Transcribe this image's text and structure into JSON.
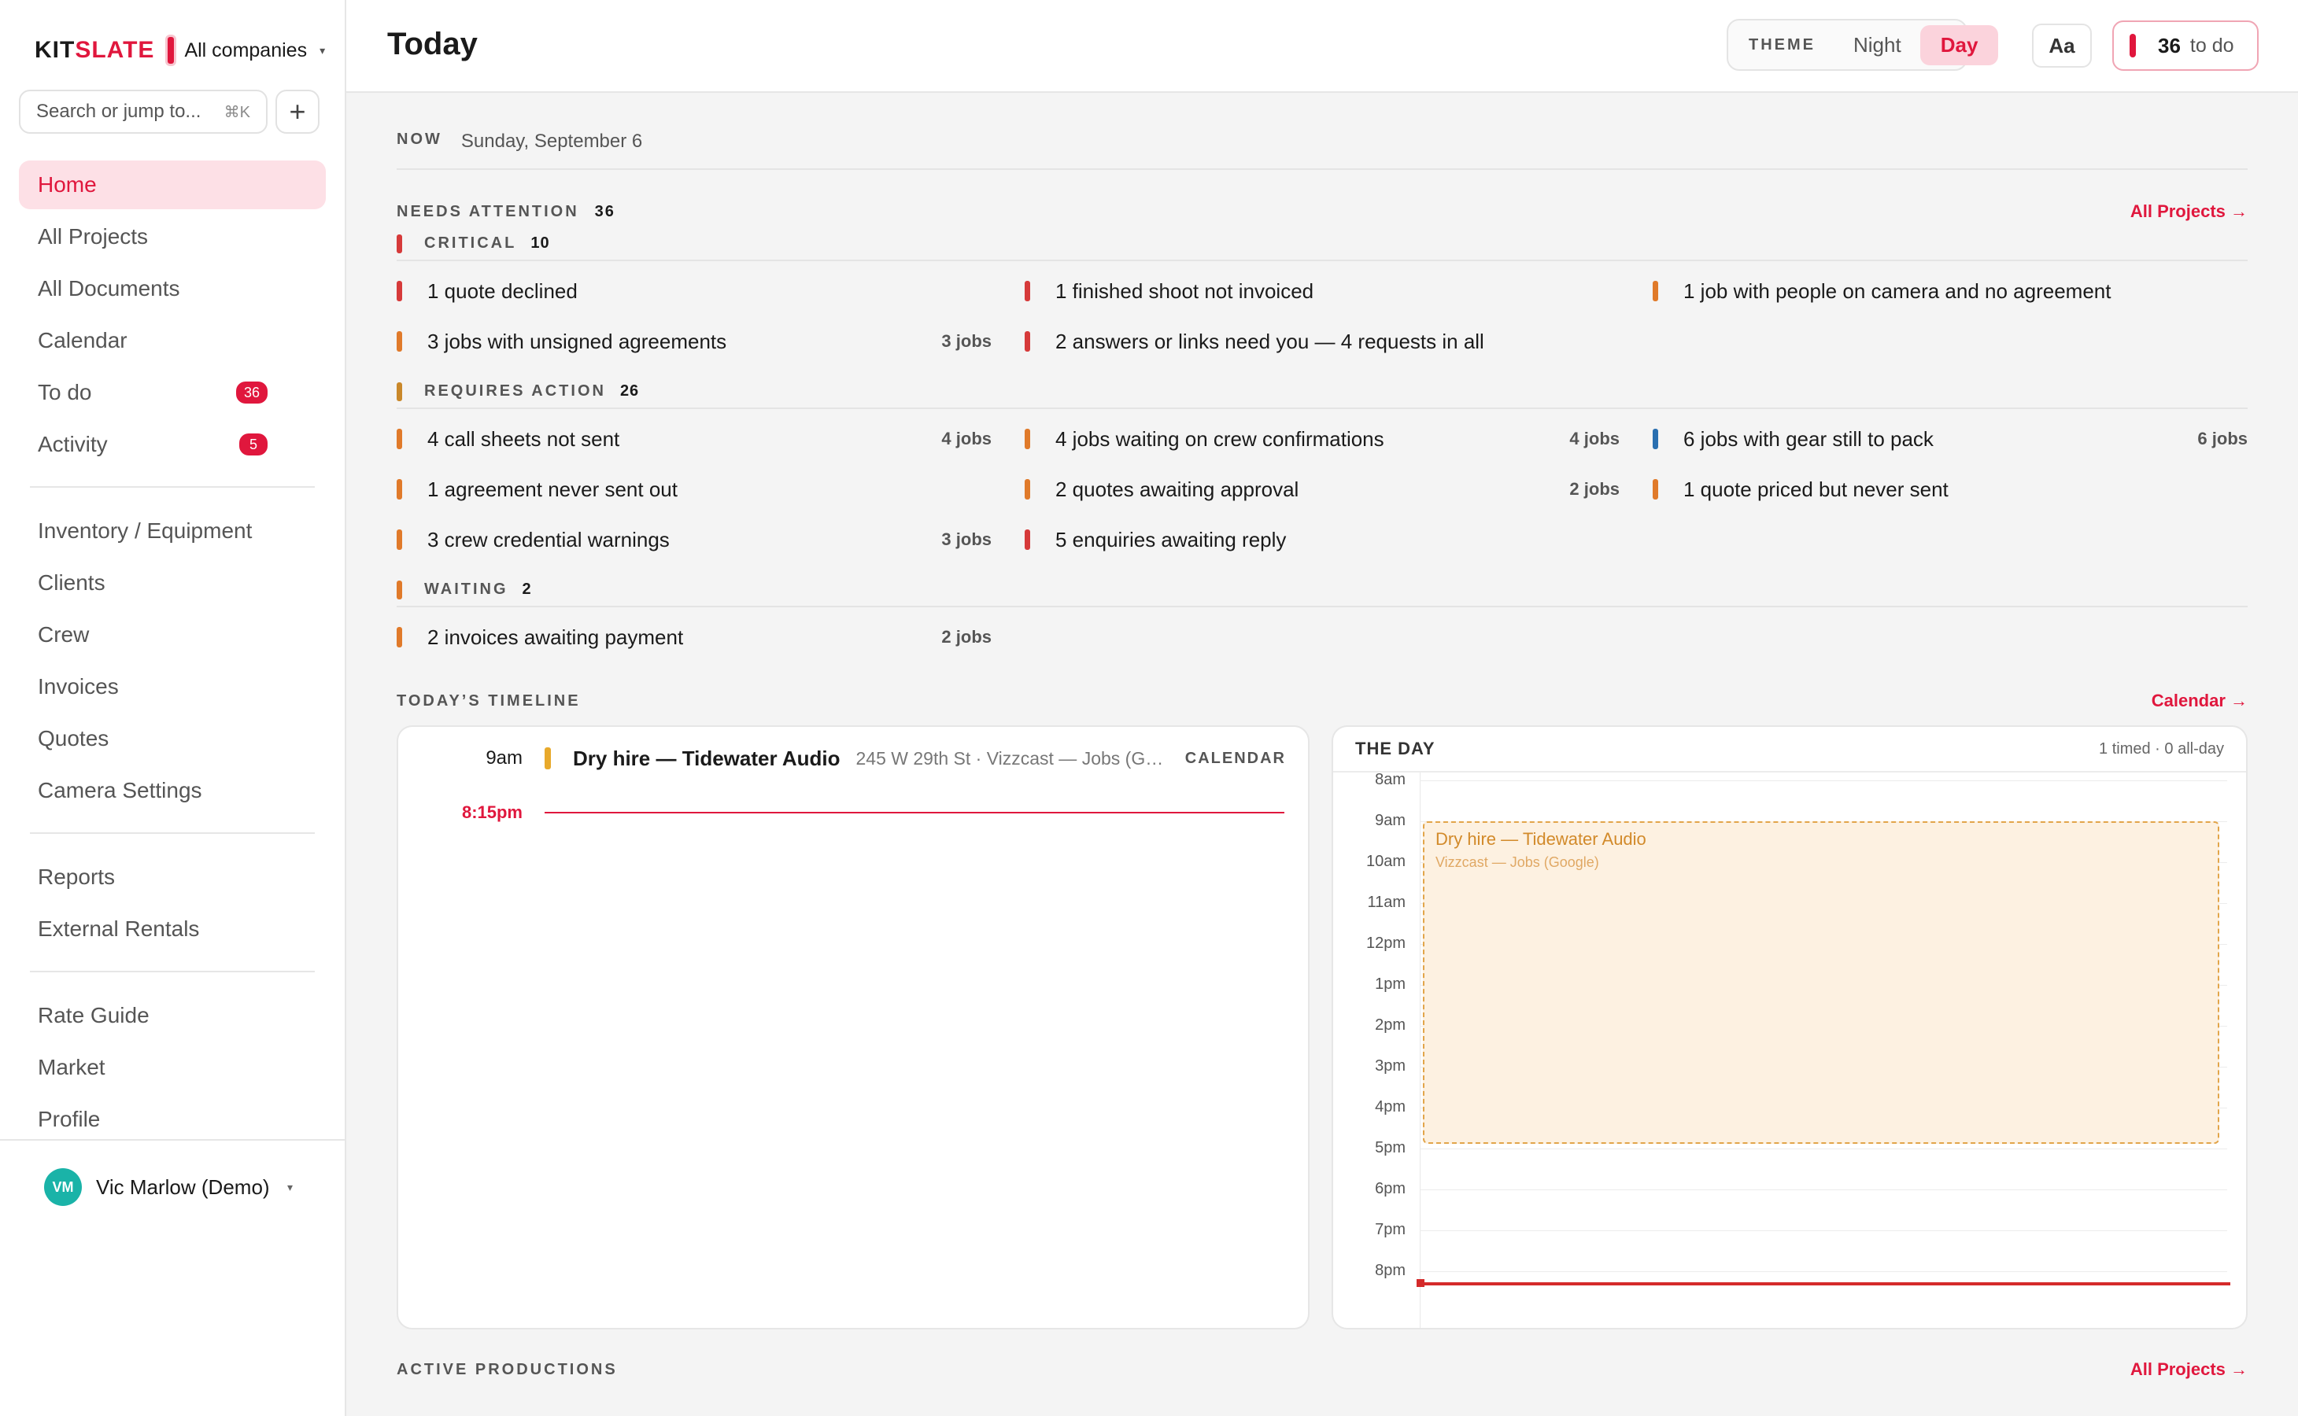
{
  "brand": {
    "logo_part1": "KIT",
    "logo_part2": "SLATE",
    "company": "All companies",
    "caret": "▾"
  },
  "search": {
    "placeholder": "Search or jump to...",
    "shortcut": "⌘K",
    "add_label": "+"
  },
  "nav": {
    "primary": [
      {
        "label": "Home",
        "active": true
      },
      {
        "label": "All Projects"
      },
      {
        "label": "All Documents"
      },
      {
        "label": "Calendar"
      },
      {
        "label": "To do",
        "badge": "36"
      },
      {
        "label": "Activity",
        "badge": "5"
      }
    ],
    "secondary": [
      "Inventory / Equipment",
      "Clients",
      "Crew",
      "Invoices",
      "Quotes",
      "Camera Settings"
    ],
    "tertiary": [
      "Reports",
      "External Rentals"
    ],
    "quaternary": [
      "Rate Guide",
      "Market",
      "Profile"
    ]
  },
  "user": {
    "initials": "VM",
    "name": "Vic Marlow (Demo)",
    "caret": "▾"
  },
  "topbar": {
    "title": "Today",
    "theme_label": "THEME",
    "theme_night": "Night",
    "theme_day": "Day",
    "font_button": "Aa",
    "todo_count": "36",
    "todo_label": "to do"
  },
  "now": {
    "label": "NOW",
    "date": "Sunday, September 6"
  },
  "attention": {
    "label": "NEEDS ATTENTION",
    "count": "36",
    "link": "All Projects →",
    "groups": [
      {
        "name": "CRITICAL",
        "count": "10",
        "color": "#d63a3a",
        "items": [
          {
            "text": "1 quote declined",
            "jobs": "",
            "color": "#d63a3a"
          },
          {
            "text": "1 finished shoot not invoiced",
            "jobs": "",
            "color": "#d63a3a"
          },
          {
            "text": "1 job with people on camera and no agreement",
            "jobs": "",
            "color": "#e07a2a"
          },
          {
            "text": "3 jobs with unsigned agreements",
            "jobs": "3 jobs",
            "color": "#e07a2a"
          },
          {
            "text": "2 answers or links need you — 4 requests in all",
            "jobs": "",
            "color": "#d63a3a"
          }
        ]
      },
      {
        "name": "REQUIRES ACTION",
        "count": "26",
        "color": "#c9882a",
        "items": [
          {
            "text": "4 call sheets not sent",
            "jobs": "4 jobs",
            "color": "#e07a2a"
          },
          {
            "text": "4 jobs waiting on crew confirmations",
            "jobs": "4 jobs",
            "color": "#e07a2a"
          },
          {
            "text": "6 jobs with gear still to pack",
            "jobs": "6 jobs",
            "color": "#2a6fb0"
          },
          {
            "text": "1 agreement never sent out",
            "jobs": "",
            "color": "#e07a2a"
          },
          {
            "text": "2 quotes awaiting approval",
            "jobs": "2 jobs",
            "color": "#e07a2a"
          },
          {
            "text": "1 quote priced but never sent",
            "jobs": "",
            "color": "#e07a2a"
          },
          {
            "text": "3 crew credential warnings",
            "jobs": "3 jobs",
            "color": "#e07a2a"
          },
          {
            "text": "5 enquiries awaiting reply",
            "jobs": "",
            "color": "#d63a3a"
          }
        ]
      },
      {
        "name": "WAITING",
        "count": "2",
        "color": "#e07a2a",
        "items": [
          {
            "text": "2 invoices awaiting payment",
            "jobs": "2 jobs",
            "color": "#e07a2a"
          }
        ]
      }
    ]
  },
  "timeline": {
    "label": "TODAY’S TIMELINE",
    "link": "Calendar →",
    "event": {
      "time": "9am",
      "title": "Dry hire — Tidewater Audio",
      "meta": "245 W 29th St · Vizzcast — Jobs (Goo...",
      "source": "CALENDAR"
    },
    "now_time": "8:15pm"
  },
  "day": {
    "title": "THE DAY",
    "summary": "1 timed · 0 all-day",
    "hours": [
      "8am",
      "9am",
      "10am",
      "11am",
      "12pm",
      "1pm",
      "2pm",
      "3pm",
      "4pm",
      "5pm",
      "6pm",
      "7pm",
      "8pm"
    ],
    "event_title": "Dry hire — Tidewater Audio",
    "event_sub": "Vizzcast — Jobs (Google)"
  },
  "active": {
    "label": "ACTIVE PRODUCTIONS",
    "link": "All Projects →"
  }
}
